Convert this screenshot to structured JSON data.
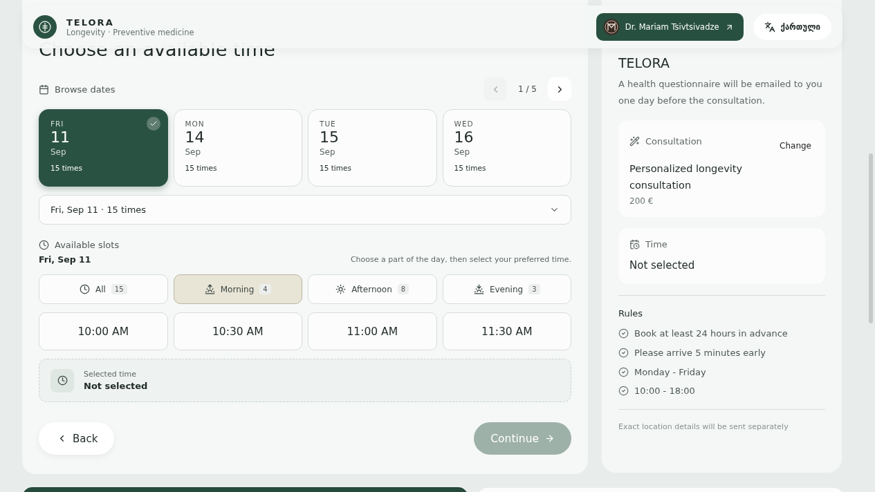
{
  "header": {
    "brand": "TELORA",
    "tagline": "Longevity · Preventive medicine",
    "doctor": "Dr. Mariam Tsivtsivadze",
    "language": "ქართული"
  },
  "booking": {
    "title": "Choose an available time",
    "browse_label": "Browse dates",
    "pager": "1 / 5",
    "dates": [
      {
        "weekday": "FRI",
        "day": "11",
        "month": "Sep",
        "times": "15 times",
        "selected": true
      },
      {
        "weekday": "MON",
        "day": "14",
        "month": "Sep",
        "times": "15 times",
        "selected": false
      },
      {
        "weekday": "TUE",
        "day": "15",
        "month": "Sep",
        "times": "15 times",
        "selected": false
      },
      {
        "weekday": "WED",
        "day": "16",
        "month": "Sep",
        "times": "15 times",
        "selected": false
      }
    ],
    "date_select": "Fri, Sep 11 · 15 times",
    "slots_label": "Available slots",
    "slots_date": "Fri, Sep 11",
    "hint": "Choose a part of the day, then select your preferred time.",
    "filters": [
      {
        "kind": "all",
        "label": "All",
        "count": "15",
        "selected": false
      },
      {
        "kind": "morning",
        "label": "Morning",
        "count": "4",
        "selected": true
      },
      {
        "kind": "afternoon",
        "label": "Afternoon",
        "count": "8",
        "selected": false
      },
      {
        "kind": "evening",
        "label": "Evening",
        "count": "3",
        "selected": false
      }
    ],
    "times": [
      {
        "label": "10:00 AM",
        "selected": false
      },
      {
        "label": "10:30 AM",
        "selected": false
      },
      {
        "label": "11:00 AM",
        "selected": false
      },
      {
        "label": "11:30 AM",
        "selected": false
      }
    ],
    "selected_time": {
      "label": "Selected time",
      "value": "Not selected"
    },
    "back": "Back",
    "continue": {
      "label": "Continue",
      "disabled": true
    }
  },
  "summary": {
    "title": "TELORA",
    "description": "A health questionnaire will be emailed to you one day before the consultation.",
    "consultation": {
      "label": "Consultation",
      "change": "Change",
      "name": "Personalized longevity consultation",
      "price": "200 €"
    },
    "time": {
      "label": "Time",
      "value": "Not selected"
    },
    "rules_title": "Rules",
    "rules": [
      "Book at least 24 hours in advance",
      "Please arrive 5 minutes early",
      "Monday - Friday",
      "10:00 - 18:00"
    ],
    "footnote": "Exact location details will be sent separately"
  }
}
